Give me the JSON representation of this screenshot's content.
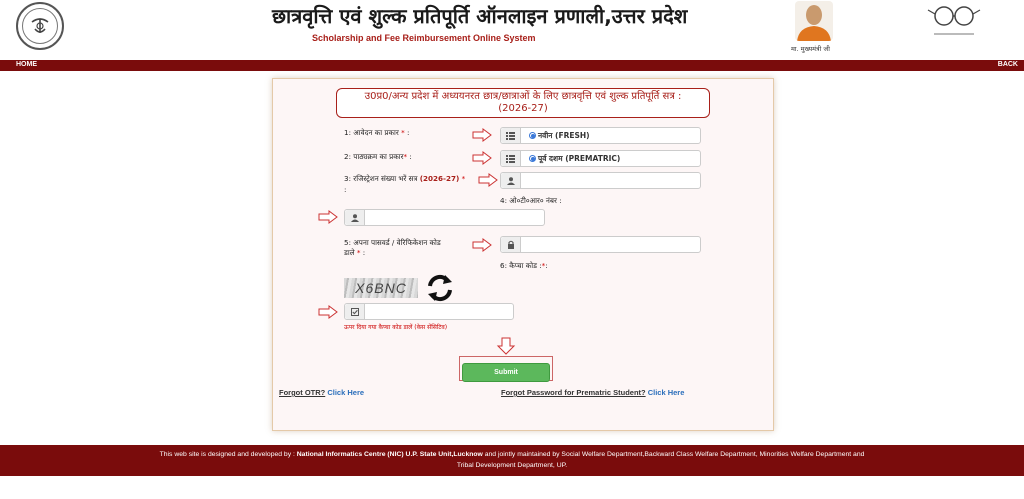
{
  "header": {
    "title_hi": "छात्रवृत्ति एवं शुल्क प्रतिपूर्ति ऑनलाइन प्रणाली,उत्तर प्रदेश",
    "title_en": "Scholarship and Fee Reimbursement Online System",
    "cm_label": "मा. मुख्यमंत्री जी"
  },
  "nav": {
    "home": "HOME",
    "back": "BACK"
  },
  "form": {
    "session_title": "उ0प्र0/अन्य प्रदेश में अध्ययनरत छात्र/छात्राओं के लिए छात्रवृत्ति एवं शुल्क प्रतिपूर्ति सत्र :",
    "session_year": "(2026-27)",
    "q1_label": "1: आवेदन का प्रकार ",
    "q1_value": "नवीन (FRESH)",
    "q2_label": "2: पाठ्यक्रम का प्रकार",
    "q2_value": "पूर्व दशम (PREMATRIC)",
    "q3_label": "3: रजिस्ट्रेशन संख्या भरें सत्र ",
    "q3_year": "(2026-27)",
    "q3_colon": ":",
    "q4_label": "4: ओ०टी०आर० नंबर :",
    "q5_label_line1": "5: अपना पासवर्ड / वेरिफिकेशन कोड",
    "q5_label_line2": "डाले ",
    "q6_label": "6: कैप्चा कोड :",
    "captcha_text": "X6BNC",
    "captcha_hint": "ऊपर दिया गया कैप्चा कोड डालें (केस सेंसिटिव)",
    "required_mark": "*",
    "colon": ":",
    "submit_label": "Submit"
  },
  "links": {
    "forgot_otr": "Forgot OTR?",
    "forgot_password": "Forgot Password for Prematric Student?",
    "click_here": "Click Here"
  },
  "footer": {
    "line1_a": "This web site is designed and developed by : ",
    "line1_b": "National Informatics Centre (NIC) U.P. State Unit,Lucknow",
    "line1_c": " and jointly maintained by Social Welfare Department,Backward Class Welfare Department, Minorities Welfare Department and",
    "line2": "Tribal Development Department, UP."
  },
  "colors": {
    "brand_maroon": "#7a0c0c",
    "accent_red": "#a8201a",
    "submit_green": "#5cb85c",
    "link_blue": "#2a6ebb"
  }
}
